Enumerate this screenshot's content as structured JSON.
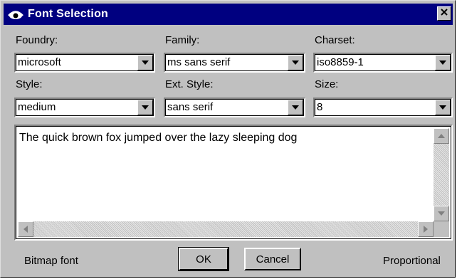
{
  "window": {
    "title": "Font Selection",
    "close_glyph": "✕"
  },
  "fields": {
    "foundry": {
      "label": "Foundry:",
      "value": "microsoft"
    },
    "family": {
      "label": "Family:",
      "value": "ms sans serif"
    },
    "charset": {
      "label": "Charset:",
      "value": "iso8859-1"
    },
    "style": {
      "label": "Style:",
      "value": "medium"
    },
    "ext_style": {
      "label": "Ext. Style:",
      "value": "sans serif"
    },
    "size": {
      "label": "Size:",
      "value": "8"
    }
  },
  "preview": {
    "text": "The quick brown fox jumped over the lazy sleeping dog"
  },
  "footer": {
    "font_type": "Bitmap font",
    "ok_label": "OK",
    "cancel_label": "Cancel",
    "spacing": "Proportional"
  },
  "icons": {
    "title": "eye-icon",
    "close": "close-icon",
    "dropdown": "chevron-down-icon"
  },
  "colors": {
    "titlebar": "#000080",
    "face": "#c0c0c0"
  }
}
